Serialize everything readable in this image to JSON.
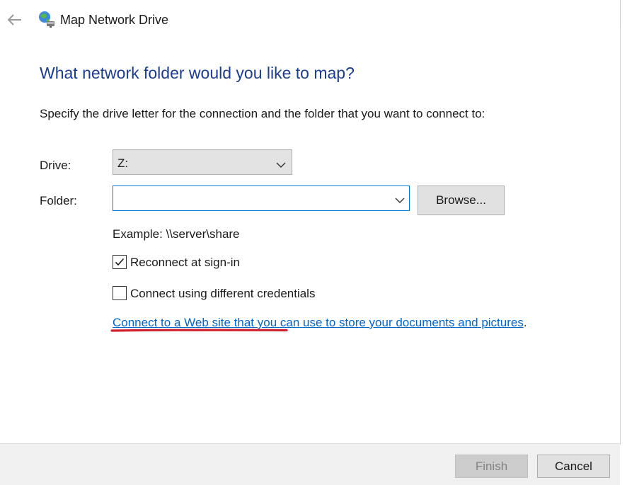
{
  "window": {
    "title": "Map Network Drive",
    "back_icon": "back-arrow-icon",
    "app_icon": "network-drive-icon"
  },
  "main": {
    "heading": "What network folder would you like to map?",
    "instruction": "Specify the drive letter for the connection and the folder that you want to connect to:",
    "drive": {
      "label": "Drive:",
      "selected": "Z:"
    },
    "folder": {
      "label": "Folder:",
      "value": "",
      "browse_label": "Browse..."
    },
    "example": "Example: \\\\server\\share",
    "reconnect": {
      "label": "Reconnect at sign-in",
      "checked": true
    },
    "credentials": {
      "label": "Connect using different credentials",
      "checked": false
    },
    "web_link": {
      "text": "Connect to a Web site that you can use to store your documents and pictures",
      "trailing": "."
    }
  },
  "footer": {
    "finish_label": "Finish",
    "finish_enabled": false,
    "cancel_label": "Cancel"
  },
  "colors": {
    "heading": "#1c3d8f",
    "link": "#0066cc",
    "annotation_underline": "#d0202e",
    "focus_border": "#0078d7"
  }
}
